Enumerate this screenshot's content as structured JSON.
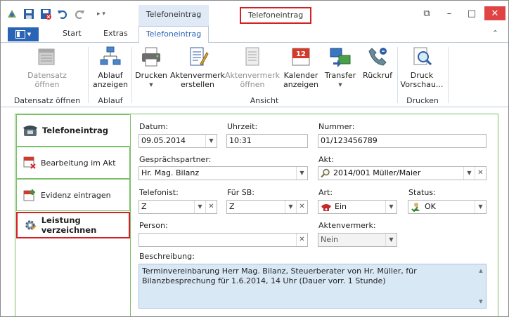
{
  "window": {
    "context_tab_label": "Telefoneintrag",
    "title": "Telefoneintrag",
    "controls": {
      "restore": "⧉",
      "minimize": "–",
      "maximize": "□",
      "close": "✕"
    }
  },
  "qat": {
    "icons": [
      "app-icon",
      "save-icon",
      "save-close-icon",
      "undo-icon",
      "redo-icon",
      "customize-icon"
    ]
  },
  "tabs": {
    "items": [
      "Start",
      "Extras",
      "Telefoneintrag"
    ],
    "active": "Telefoneintrag"
  },
  "ribbon": {
    "groups": {
      "datensatz": "Datensatz öffnen",
      "ablauf": "Ablauf",
      "ansicht": "Ansicht",
      "drucken": "Drucken"
    },
    "buttons": {
      "datensatz_oeffnen": {
        "line1": "Datensatz",
        "line2": "öffnen"
      },
      "ablauf_anzeigen": {
        "line1": "Ablauf",
        "line2": "anzeigen"
      },
      "drucken": {
        "line1": "Drucken"
      },
      "aktenvermerk_erstellen": {
        "line1": "Aktenvermerk",
        "line2": "erstellen"
      },
      "aktenvermerk_oeffnen": {
        "line1": "Aktenvermerk",
        "line2": "öffnen"
      },
      "kalender_anzeigen": {
        "line1": "Kalender",
        "line2": "anzeigen"
      },
      "transfer": {
        "line1": "Transfer"
      },
      "rueckruf": {
        "line1": "Rückruf"
      },
      "druck_vorschau": {
        "line1": "Druck",
        "line2": "Vorschau..."
      }
    }
  },
  "nav": {
    "telefoneintrag": "Telefoneintrag",
    "bearbeitung": "Bearbeitung im Akt",
    "evidenz": "Evidenz eintragen",
    "leistung": "Leistung verzeichnen"
  },
  "form": {
    "datum": {
      "label": "Datum:",
      "value": "09.05.2014"
    },
    "uhrzeit": {
      "label": "Uhrzeit:",
      "value": "10:31"
    },
    "nummer": {
      "label": "Nummer:",
      "value": "01/123456789"
    },
    "gespraechspartner": {
      "label": "Gesprächspartner:",
      "value": "Hr. Mag. Bilanz"
    },
    "akt": {
      "label": "Akt:",
      "value": "2014/001 Müller/Maier"
    },
    "telefonist": {
      "label": "Telefonist:",
      "value": "Z"
    },
    "fuer_sb": {
      "label": "Für SB:",
      "value": "Z"
    },
    "art": {
      "label": "Art:",
      "value": "Ein"
    },
    "status": {
      "label": "Status:",
      "value": "OK"
    },
    "person": {
      "label": "Person:",
      "value": ""
    },
    "aktenvermerk": {
      "label": "Aktenvermerk:",
      "value": "Nein"
    },
    "beschreibung": {
      "label": "Beschreibung:",
      "value": "Terminvereinbarung Herr Mag. Bilanz, Steuerberater von Hr. Müller, für Bilanzbesprechung für 1.6.2014, 14 Uhr (Dauer vorr. 1 Stunde)"
    }
  }
}
